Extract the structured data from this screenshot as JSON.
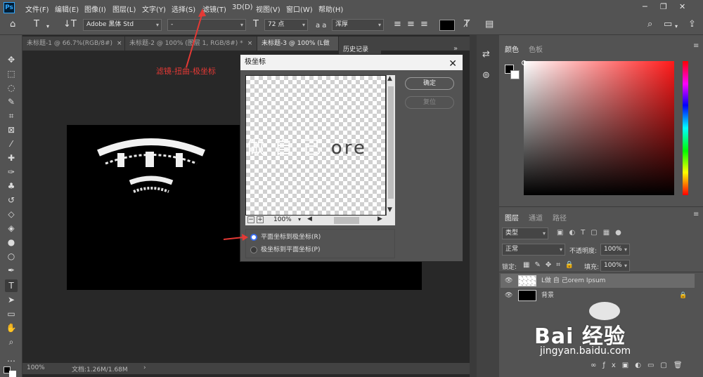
{
  "app": {
    "logo": "Ps"
  },
  "menubar": {
    "items": [
      "文件(F)",
      "编辑(E)",
      "图像(I)",
      "图层(L)",
      "文字(Y)",
      "选择(S)",
      "滤镜(T)",
      "3D(D)",
      "视图(V)",
      "窗口(W)",
      "帮助(H)"
    ]
  },
  "options": {
    "font_family": "Adobe 黑体 Std",
    "font_style": "-",
    "font_size": "72 点",
    "aa_label": "a a",
    "aa_value": "浑厚"
  },
  "tabs": [
    {
      "label": "未标题-1 @ 66.7%(RGB/8#)",
      "close": "×"
    },
    {
      "label": "未标题-2 @ 100% (图层 1, RGB/8#) *",
      "close": "×"
    },
    {
      "label": "未标题-3 @ 100% (L做",
      "close": ""
    }
  ],
  "annotation": "滤镜-扭曲-极坐标",
  "history_tab": "历史记录",
  "dialog": {
    "title": "极坐标",
    "preview_text_light": "做 自 己",
    "preview_text_dark": "ore",
    "zoom": "100%",
    "ok": "确定",
    "reset": "复位",
    "options": [
      {
        "label": "平面坐标到极坐标(R)",
        "checked": true
      },
      {
        "label": "极坐标到平面坐标(P)",
        "checked": false
      }
    ]
  },
  "status": {
    "zoom": "100%",
    "doc": "文档:1.26M/1.68M"
  },
  "color_panel": {
    "tabs": [
      "颜色",
      "色板"
    ]
  },
  "layers_panel": {
    "tabs": [
      "图层",
      "通道",
      "路径"
    ],
    "kind": "类型",
    "blend_mode": "正常",
    "opacity_label": "不透明度:",
    "opacity_value": "100%",
    "lock_label": "锁定:",
    "fill_label": "填充:",
    "fill_value": "100%",
    "layers": [
      {
        "name": "L做 自 己orem Ipsum",
        "selected": true
      },
      {
        "name": "背景",
        "selected": false
      }
    ]
  },
  "watermark": {
    "brand": "Bai  经验",
    "url": "jingyan.baidu.com"
  }
}
